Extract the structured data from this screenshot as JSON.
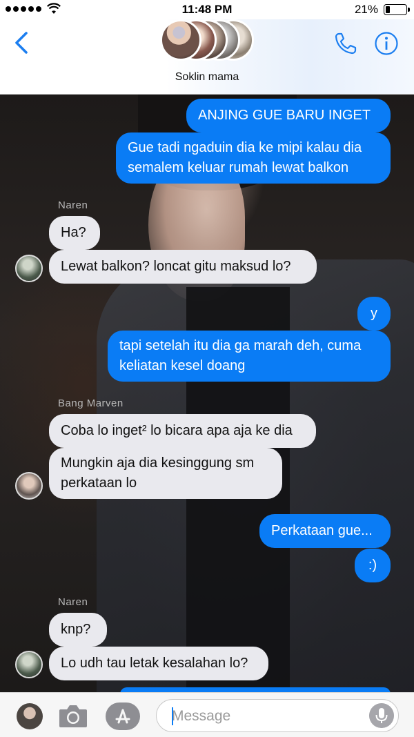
{
  "status_bar": {
    "time": "11:48 PM",
    "battery_percent": "21%",
    "battery_level": 0.21
  },
  "header": {
    "contact_name": "Soklin mama",
    "back_icon": "chevron-left-icon",
    "phone_icon": "phone-icon",
    "info_icon": "info-icon"
  },
  "colors": {
    "outgoing_bubble": "#0a7cf5",
    "incoming_bubble": "#e9e9ee",
    "accent": "#1b7ef0"
  },
  "messages": {
    "m1": "ANJING GUE BARU INGET",
    "m2_line1": "Gue tadi ngaduin dia ke mipi kalau dia",
    "m2_line2": "semalem keluar rumah lewat balkon",
    "sender1": "Naren",
    "m3": "Ha?",
    "m4": "Lewat balkon? loncat gitu maksud lo?",
    "m5": "y",
    "m6_line1": "tapi setelah itu dia ga marah deh, cuma",
    "m6_line2": "keliatan kesel doang",
    "sender2": "Bang Marven",
    "m7": "Coba lo inget² lo bicara apa aja ke dia",
    "m8_line1": "Mungkin aja dia kesinggung sm",
    "m8_line2": "perkataan lo",
    "m9": "Perkataan gue...",
    "m10": ":)",
    "sender3": "Naren",
    "m11": "knp?",
    "m12": "Lo udh tau letak kesalahan lo?"
  },
  "input_bar": {
    "placeholder": "Message"
  }
}
